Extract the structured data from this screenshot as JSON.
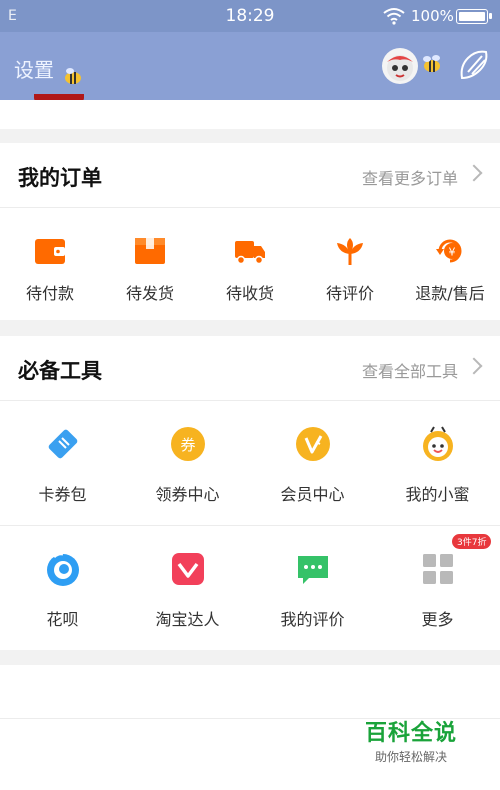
{
  "status_bar": {
    "carrier": "E",
    "time": "18:29",
    "battery": "100%"
  },
  "header": {
    "settings_label": "设置"
  },
  "orders": {
    "title": "我的订单",
    "more_label": "查看更多订单",
    "items": [
      {
        "label": "待付款",
        "icon": "wallet-icon"
      },
      {
        "label": "待发货",
        "icon": "box-icon"
      },
      {
        "label": "待收货",
        "icon": "truck-icon"
      },
      {
        "label": "待评价",
        "icon": "flower-icon"
      },
      {
        "label": "退款/售后",
        "icon": "refund-icon"
      }
    ]
  },
  "tools": {
    "title": "必备工具",
    "more_label": "查看全部工具",
    "items": [
      {
        "label": "卡券包",
        "icon": "ticket-icon"
      },
      {
        "label": "领券中心",
        "icon": "coupon-icon"
      },
      {
        "label": "会员中心",
        "icon": "vip-icon"
      },
      {
        "label": "我的小蜜",
        "icon": "bee-assistant-icon"
      },
      {
        "label": "花呗",
        "icon": "huabei-icon"
      },
      {
        "label": "淘宝达人",
        "icon": "daren-icon"
      },
      {
        "label": "我的评价",
        "icon": "comment-icon"
      },
      {
        "label": "更多",
        "icon": "grid-icon",
        "badge": "3件7折"
      }
    ]
  },
  "watermark": {
    "main": "百科全说",
    "sub": "助你轻松解决"
  },
  "colors": {
    "accent": "#ff6a00",
    "header_bg": "#8aa0d4",
    "badge": "#e8383d"
  }
}
